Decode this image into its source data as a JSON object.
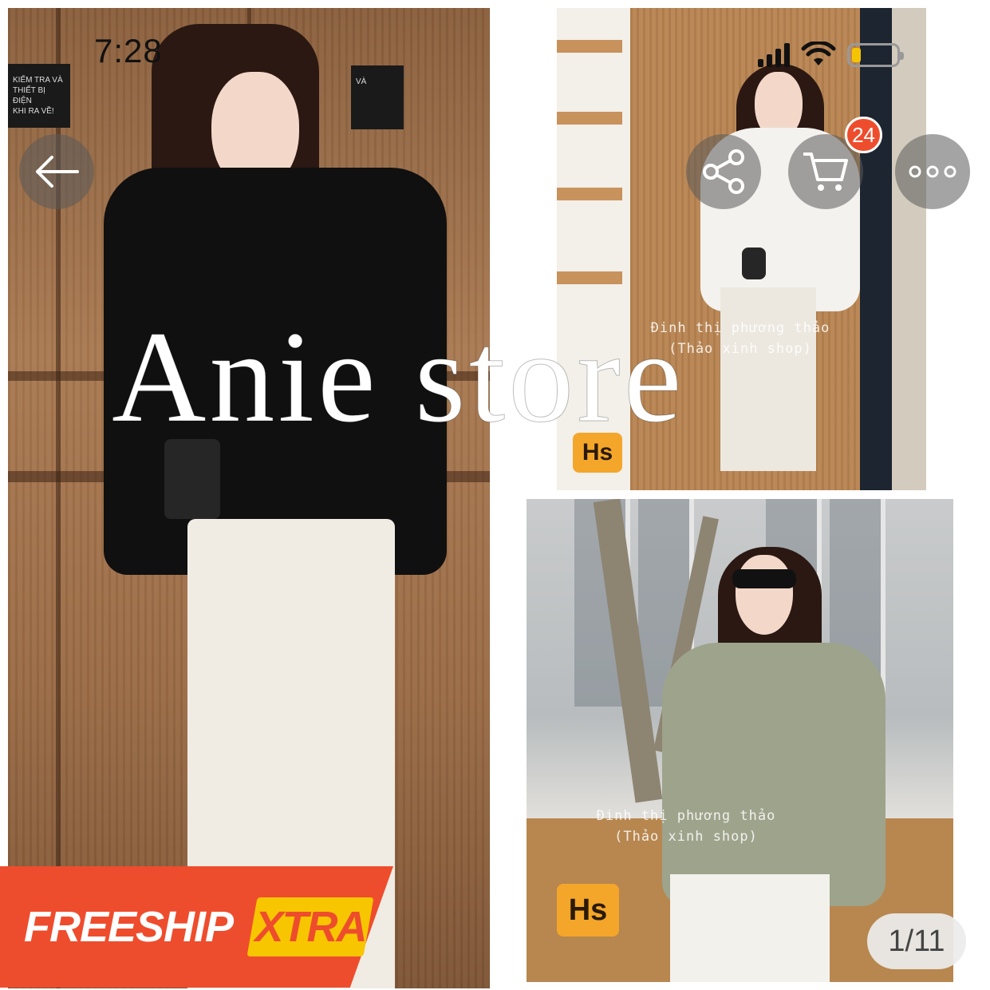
{
  "status_bar": {
    "time": "7:28",
    "battery_level": 0.2,
    "battery_color": "#f5c400"
  },
  "watermark": {
    "text": "Anie store"
  },
  "photos": {
    "main": {
      "sign_left": "KIỂM TRA VÀ\nTHIẾT BỊ ĐIỆN\nKHI RA VỀ!",
      "sign_right": "VÀ"
    },
    "top_right": {
      "credit_line1": "Đinh thị phương thảo",
      "credit_line2": "(Thảo xinh shop)",
      "badge": "Hs"
    },
    "bottom_right": {
      "credit_line1": "Đinh thị phương thảo",
      "credit_line2": "(Thảo xinh shop)",
      "badge": "Hs"
    }
  },
  "toolbar": {
    "back_icon": "arrow-left-icon",
    "share_icon": "share-icon",
    "cart_icon": "cart-icon",
    "cart_count": "24",
    "more_icon": "more-horizontal-icon"
  },
  "promo": {
    "freeship_label": "FREESHIP",
    "xtra_label": "XTRA",
    "brand_color": "#ee4d2d",
    "xtra_color": "#f7c600"
  },
  "gallery": {
    "page_indicator": "1/11"
  }
}
